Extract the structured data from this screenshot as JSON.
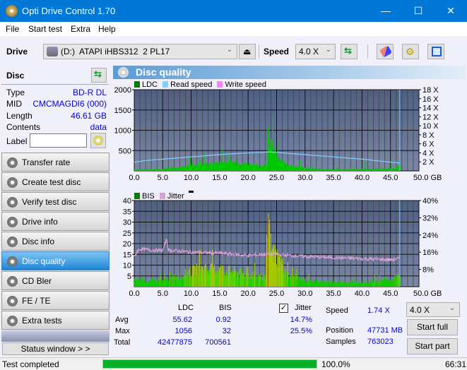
{
  "window": {
    "title": "Opti Drive Control 1.70",
    "minimize": "—",
    "maximize": "☐",
    "close": "✕"
  },
  "menu": [
    "File",
    "Start test",
    "Extra",
    "Help"
  ],
  "toolbar": {
    "drive_label": "Drive",
    "drive_value": "(D:)  ATAPI iHBS312  2 PL17",
    "speed_label": "Speed",
    "speed_value": "4.0 X"
  },
  "disc": {
    "header": "Disc",
    "rows": [
      {
        "key": "Type",
        "value": "BD-R DL"
      },
      {
        "key": "MID",
        "value": "CMCMAGDI6 (000)"
      },
      {
        "key": "Length",
        "value": "46.61 GB"
      },
      {
        "key": "Contents",
        "value": "data"
      }
    ],
    "label_key": "Label",
    "label_value": ""
  },
  "nav": [
    {
      "label": "Transfer rate",
      "active": false
    },
    {
      "label": "Create test disc",
      "active": false
    },
    {
      "label": "Verify test disc",
      "active": false
    },
    {
      "label": "Drive info",
      "active": false
    },
    {
      "label": "Disc info",
      "active": false
    },
    {
      "label": "Disc quality",
      "active": true
    },
    {
      "label": "CD Bler",
      "active": false
    },
    {
      "label": "FE / TE",
      "active": false
    },
    {
      "label": "Extra tests",
      "active": false
    }
  ],
  "status_window_btn": "Status window > >",
  "panel_title": "Disc quality",
  "colors": {
    "ldc": "#00c800",
    "read_speed": "#7fd0ff",
    "write_speed": "#ff80ff",
    "bis": "#00a000",
    "jitter": "#d8a0d8",
    "accent": "#0078d7",
    "progress": "#06b025"
  },
  "chart_data": [
    {
      "type": "bar",
      "title": "LDC",
      "legend": [
        "LDC",
        "Read speed",
        "Write speed"
      ],
      "legend_placement": "top-left",
      "xlabel": "GB",
      "x_ticks": [
        "0.0",
        "5.0",
        "10.0",
        "15.0",
        "20.0",
        "25.0",
        "30.0",
        "35.0",
        "40.0",
        "45.0",
        "50.0 GB"
      ],
      "xlim": [
        0,
        50
      ],
      "ylim": [
        0,
        2000
      ],
      "y_ticks": [
        "500",
        "1000",
        "1500",
        "2000"
      ],
      "y2_ticks": [
        "2 X",
        "4 X",
        "6 X",
        "8 X",
        "10 X",
        "12 X",
        "14 X",
        "16 X",
        "18 X"
      ],
      "y2lim": [
        0,
        18
      ],
      "grid": true,
      "end_marker_gb": 46.61,
      "ldc_profile": {
        "x": [
          0,
          2,
          4,
          6,
          8,
          10,
          12,
          14,
          16,
          18,
          20,
          22,
          23.3,
          23.5,
          24,
          25,
          26,
          28,
          30,
          32,
          34,
          36,
          38,
          40,
          42,
          44,
          46,
          46.6
        ],
        "y": [
          30,
          30,
          40,
          60,
          90,
          130,
          160,
          190,
          220,
          200,
          170,
          130,
          100,
          1056,
          600,
          350,
          200,
          120,
          70,
          50,
          40,
          35,
          35,
          40,
          45,
          50,
          60,
          150
        ]
      },
      "ldc_spikes": [
        {
          "x": 9.7,
          "y": 350
        },
        {
          "x": 10.3,
          "y": 250
        },
        {
          "x": 15.3,
          "y": 550
        },
        {
          "x": 17.8,
          "y": 280
        },
        {
          "x": 23.4,
          "y": 1056
        },
        {
          "x": 24.1,
          "y": 700
        },
        {
          "x": 24.7,
          "y": 650
        },
        {
          "x": 40.5,
          "y": 250
        },
        {
          "x": 44.8,
          "y": 280
        }
      ],
      "read_speed": {
        "x": [
          0,
          2,
          5,
          8,
          10,
          13,
          16,
          19,
          22,
          23.5,
          25,
          28,
          31,
          34,
          37,
          40,
          43,
          46.6
        ],
        "y": [
          1.9,
          2.3,
          2.6,
          2.9,
          3.1,
          3.4,
          3.7,
          3.9,
          4.1,
          4.2,
          4.1,
          3.8,
          3.5,
          3.2,
          2.9,
          2.6,
          2.2,
          1.74
        ]
      }
    },
    {
      "type": "bar",
      "title": "BIS / Jitter",
      "legend": [
        "BIS",
        "Jitter"
      ],
      "legend_placement": "top-left",
      "xlabel": "GB",
      "x_ticks": [
        "0.0",
        "5.0",
        "10.0",
        "15.0",
        "20.0",
        "25.0",
        "30.0",
        "35.0",
        "40.0",
        "45.0",
        "50.0 GB"
      ],
      "xlim": [
        0,
        50
      ],
      "ylim": [
        0,
        40
      ],
      "y_ticks": [
        "5",
        "10",
        "15",
        "20",
        "25",
        "30",
        "35",
        "40"
      ],
      "y2_ticks": [
        "8%",
        "16%",
        "24%",
        "32%",
        "40%"
      ],
      "y2lim": [
        0,
        40
      ],
      "grid": true,
      "end_marker_gb": 46.61,
      "bis_profile": {
        "x": [
          0,
          3,
          5,
          7,
          9,
          11,
          13,
          15,
          17,
          19,
          21,
          23,
          23.4,
          24,
          25,
          26,
          27,
          30,
          35,
          40,
          45,
          46.6
        ],
        "y": [
          3,
          3,
          3,
          4,
          6,
          8,
          8,
          8,
          7,
          6,
          5,
          4,
          32,
          16,
          14,
          10,
          5,
          3,
          2,
          2,
          3,
          5
        ]
      },
      "jitter": {
        "x": [
          0,
          0.5,
          1,
          3,
          5,
          5.7,
          6,
          8,
          10,
          15,
          20,
          23.5,
          25,
          30,
          35,
          40,
          45,
          46.6
        ],
        "y": [
          13.5,
          16.5,
          17.5,
          17,
          16.8,
          22,
          17,
          16.5,
          16,
          15.5,
          14.5,
          15.2,
          15,
          14,
          13.5,
          13,
          12.5,
          13
        ]
      }
    }
  ],
  "stats": {
    "col_ldc": "LDC",
    "col_bis": "BIS",
    "col_jitter": "Jitter",
    "rows": [
      {
        "label": "Avg",
        "ldc": "55.62",
        "bis": "0.92",
        "jitter": "14.7%"
      },
      {
        "label": "Max",
        "ldc": "1056",
        "bis": "32",
        "jitter": "25.5%"
      },
      {
        "label": "Total",
        "ldc": "42477875",
        "bis": "700561"
      }
    ],
    "jitter_checked": true,
    "speed_label": "Speed",
    "speed_value": "1.74 X",
    "position_label": "Position",
    "position_value": "47731 MB",
    "samples_label": "Samples",
    "samples_value": "763023",
    "speed_select": "4.0 X",
    "start_full": "Start full",
    "start_part": "Start part"
  },
  "status": {
    "text": "Test completed",
    "progress_pct": 100.0,
    "progress_text": "100.0%",
    "time": "66:31"
  }
}
